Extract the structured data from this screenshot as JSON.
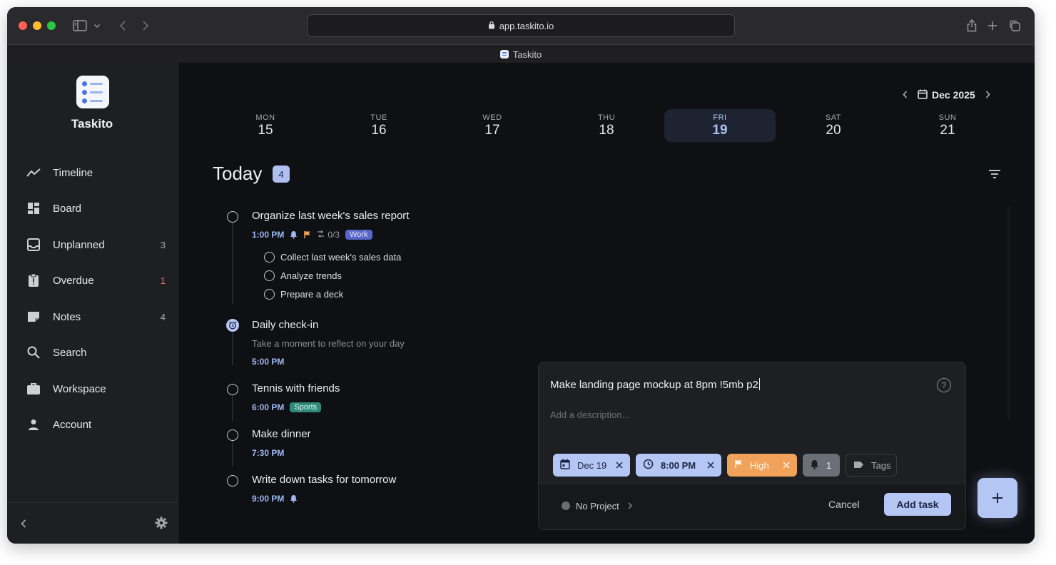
{
  "browser": {
    "url": "app.taskito.io",
    "tab_title": "Taskito"
  },
  "sidebar": {
    "brand": "Taskito",
    "items": [
      {
        "label": "Timeline",
        "icon": "timeline-icon",
        "count": ""
      },
      {
        "label": "Board",
        "icon": "board-icon",
        "count": ""
      },
      {
        "label": "Unplanned",
        "icon": "inbox-icon",
        "count": "3"
      },
      {
        "label": "Overdue",
        "icon": "clipboard-alert-icon",
        "count": "1"
      },
      {
        "label": "Notes",
        "icon": "note-icon",
        "count": "4"
      },
      {
        "label": "Search",
        "icon": "search-icon",
        "count": ""
      },
      {
        "label": "Workspace",
        "icon": "briefcase-icon",
        "count": ""
      },
      {
        "label": "Account",
        "icon": "person-icon",
        "count": ""
      }
    ]
  },
  "calendar": {
    "month_label": "Dec 2025",
    "days": [
      {
        "name": "MON",
        "date": "15"
      },
      {
        "name": "TUE",
        "date": "16"
      },
      {
        "name": "WED",
        "date": "17"
      },
      {
        "name": "THU",
        "date": "18"
      },
      {
        "name": "FRI",
        "date": "19",
        "active": true
      },
      {
        "name": "SAT",
        "date": "20"
      },
      {
        "name": "SUN",
        "date": "21"
      }
    ]
  },
  "today": {
    "title": "Today",
    "count": "4"
  },
  "tasks": [
    {
      "title": "Organize last week's sales report",
      "time": "1:00 PM",
      "subtask_progress": "0/3",
      "tag": "Work",
      "subtasks": [
        "Collect last week's sales data",
        "Analyze trends",
        "Prepare a deck"
      ]
    },
    {
      "title": "Daily check-in",
      "description": "Take a moment to reflect on your day",
      "time": "5:00 PM"
    },
    {
      "title": "Tennis with friends",
      "time": "6:00 PM",
      "tag": "Sports"
    },
    {
      "title": "Make dinner",
      "time": "7:30 PM"
    },
    {
      "title": "Write down tasks for tomorrow",
      "time": "9:00 PM"
    }
  ],
  "composer": {
    "input_value": "Make landing page mockup at 8pm !5mb p2",
    "description_placeholder": "Add a description...",
    "date_chip": "Dec 19",
    "time_chip": "8:00 PM",
    "priority_chip": "High",
    "reminder_chip": "1",
    "tags_chip": "Tags",
    "project": "No Project",
    "cancel_label": "Cancel",
    "add_label": "Add task"
  },
  "colors": {
    "accent": "#b4c6f3",
    "priority_high": "#f0a25a",
    "overdue": "#ff6b6b",
    "tag_work": "#5865c9",
    "tag_sports": "#2f8a7c"
  }
}
